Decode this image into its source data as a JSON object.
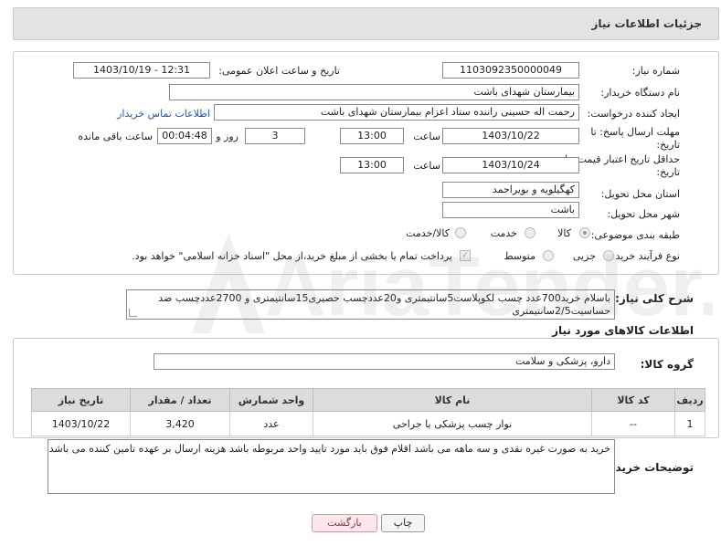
{
  "header": {
    "title": "جزئیات اطلاعات نیاز"
  },
  "fields": {
    "need_number_label": "شماره نیاز:",
    "need_number": "1103092350000049",
    "announce_label": "تاریخ و ساعت اعلان عمومی:",
    "announce_value": "1403/10/19 - 12:31",
    "buyer_org_label": "نام دستگاه خریدار:",
    "buyer_org": "بیمارستان شهدای باشت",
    "creator_label": "ایجاد کننده درخواست:",
    "creator": "رحمت اله حسینی راننده ستاد اعزام بیمارستان شهدای باشت",
    "contact_link": "اطلاعات تماس خریدار",
    "deadline_label": "مهلت ارسال پاسخ: تا تاریخ:",
    "deadline_date": "1403/10/22",
    "time_label": "ساعت",
    "deadline_time": "13:00",
    "days_value": "3",
    "days_label": "روز و",
    "remaining_time": "00:04:48",
    "remaining_label": "ساعت باقی مانده",
    "price_validity_label": "حداقل تاریخ اعتبار قیمت: تا تاریخ:",
    "price_validity_date": "1403/10/24",
    "price_validity_time": "13:00",
    "province_label": "استان محل تحویل:",
    "province": "کهگیلویه و بویراحمد",
    "city_label": "شهر محل تحویل:",
    "city": "باشت",
    "category_label": "طبقه بندی موضوعی:",
    "category_options": [
      "کالا",
      "خدمت",
      "کالا/خدمت"
    ],
    "purchase_type_label": "نوع فرآیند خرید :",
    "purchase_type_options": [
      "جزیی",
      "متوسط"
    ],
    "payment_note": "پرداخت تمام یا بخشی از مبلغ خرید،از محل \"اسناد خزانه اسلامی\" خواهد بود."
  },
  "description": {
    "label": "شرح کلی نیاز:",
    "text": "باسلام خرید700عدد چسب لکوپلاست5سانتیمتری و20عددچسب حصیری15سانتیمتری و 2700عددچسب ضد حساسیت2/5سانتیمتری"
  },
  "goods": {
    "section_title": "اطلاعات کالاهای مورد نیاز",
    "group_label": "گروه کالا:",
    "group_value": "دارو، پزشکی و سلامت",
    "table": {
      "headers": [
        "ردیف",
        "کد کالا",
        "نام کالا",
        "واحد شمارش",
        "تعداد / مقدار",
        "تاریخ نیاز"
      ],
      "rows": [
        [
          "1",
          "--",
          "نوار چسب پزشکی یا جراحی",
          "عدد",
          "3,420",
          "1403/10/22"
        ]
      ]
    }
  },
  "buyer_notes": {
    "label": "توضیحات خریدار:",
    "text": "خرید به صورت غیره نقدی و سه ماهه می باشد اقلام فوق باید مورد تایید واحد مربوطه باشد هزینه ارسال بر عهده تامین کننده می باشد"
  },
  "buttons": {
    "print": "چاپ",
    "back": "بازگشت"
  },
  "watermark": {
    "text": "AriaTender.neT"
  }
}
